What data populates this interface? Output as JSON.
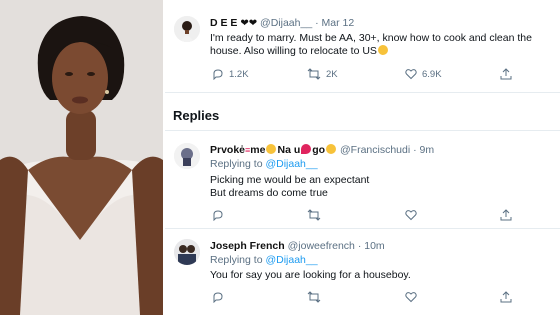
{
  "main_tweet": {
    "display_name": "D E E",
    "handle": "@Dijaah__",
    "timestamp": "Mar 12",
    "text_line1": "I'm ready to marry. Must be AA, 30+, know how to cook and clean the",
    "text_line2": "house. Also willing to relocate to US",
    "replies_count": "1.2K",
    "retweets_count": "2K",
    "likes_count": "6.9K"
  },
  "replies_section": {
    "title": "Replies"
  },
  "replies": [
    {
      "display_name_a": "Prvokė",
      "display_name_b": "me",
      "display_name_c": "Na u",
      "display_name_d": "go",
      "handle": "@Francischudi",
      "timestamp": "9m",
      "replying_prefix": "Replying to",
      "replying_to": "@Dijaah__",
      "text_line1": "Picking me would be an expectant",
      "text_line2": "But dreams do come true"
    },
    {
      "display_name": "Joseph French",
      "handle": "@joweefrench",
      "timestamp": "10m",
      "replying_prefix": "Replying to",
      "replying_to": "@Dijaah__",
      "text_line1": "You for say you are looking for a houseboy."
    }
  ],
  "icons": {
    "reply": "reply-icon",
    "retweet": "retweet-icon",
    "like": "heart-icon",
    "share": "share-icon"
  },
  "colors": {
    "link": "#1d9bf0",
    "muted": "#5b7083",
    "divider": "#e6ecf0"
  }
}
